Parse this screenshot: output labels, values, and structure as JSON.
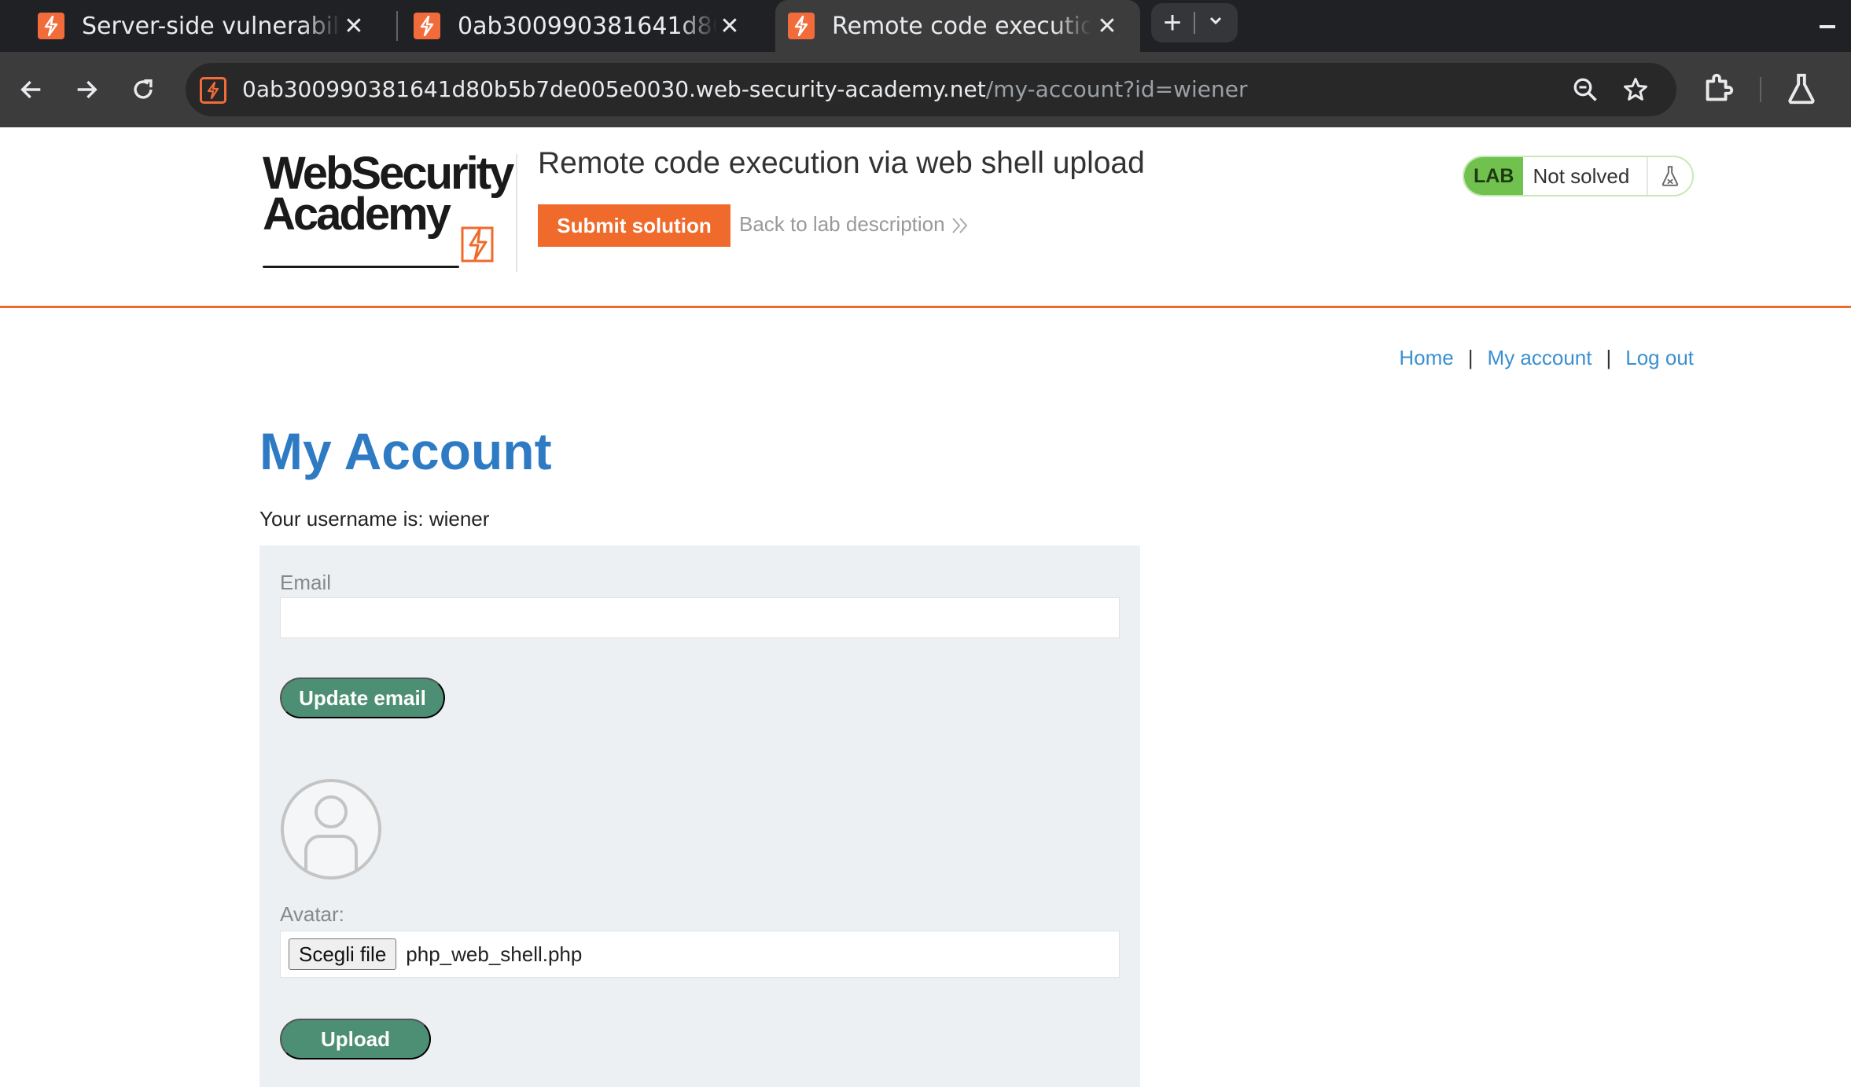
{
  "browser": {
    "tabs": [
      {
        "title": "Server-side vulnerabilities",
        "active": false
      },
      {
        "title": "0ab300990381641d80b5b7de005e0030.web-security-academy.net",
        "active": false
      },
      {
        "title": "Remote code execution via web shell upload",
        "active": true
      }
    ],
    "url_host": "0ab300990381641d80b5b7de005e0030.web-security-academy.net",
    "url_path": "/my-account?id=wiener"
  },
  "lab_header": {
    "logo_line1": "WebSecurity",
    "logo_line2": "Academy",
    "title": "Remote code execution via web shell upload",
    "submit_label": "Submit solution",
    "back_label": "Back to lab description",
    "badge_label": "LAB",
    "status": "Not solved"
  },
  "nav": {
    "home": "Home",
    "my_account": "My account",
    "log_out": "Log out",
    "separator": "|"
  },
  "page": {
    "title": "My Account",
    "username_line": "Your username is: wiener"
  },
  "form": {
    "email_label": "Email",
    "email_value": "",
    "update_label": "Update email",
    "avatar_label": "Avatar:",
    "file_button": "Scegli file",
    "file_name": "php_web_shell.php",
    "upload_label": "Upload"
  },
  "colors": {
    "accent_orange": "#f06a2b",
    "link_blue": "#3a8fd0",
    "title_blue": "#2e7bc4",
    "button_green": "#4d8f74",
    "lab_green": "#70c14e",
    "panel_bg": "#ecf0f3"
  }
}
